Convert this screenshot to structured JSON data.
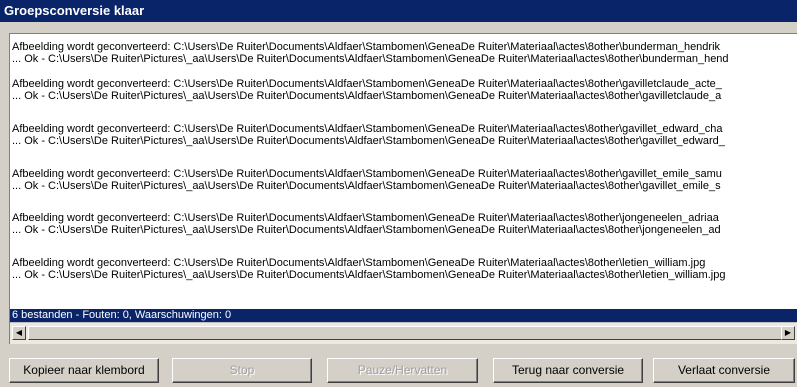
{
  "window": {
    "title": "Groepsconversie klaar"
  },
  "log": {
    "entries": [
      {
        "line1": "Afbeelding wordt geconverteerd: C:\\Users\\De Ruiter\\Documents\\Aldfaer\\Stambomen\\GeneaDe Ruiter\\Materiaal\\actes\\8other\\bunderman_hendrik",
        "line2": "... Ok - C:\\Users\\De Ruiter\\Pictures\\_aa\\Users\\De Ruiter\\Documents\\Aldfaer\\Stambomen\\GeneaDe Ruiter\\Materiaal\\actes\\8other\\bunderman_hend"
      },
      {
        "line1": "Afbeelding wordt geconverteerd: C:\\Users\\De Ruiter\\Documents\\Aldfaer\\Stambomen\\GeneaDe Ruiter\\Materiaal\\actes\\8other\\gavilletclaude_acte_",
        "line2": "... Ok - C:\\Users\\De Ruiter\\Pictures\\_aa\\Users\\De Ruiter\\Documents\\Aldfaer\\Stambomen\\GeneaDe Ruiter\\Materiaal\\actes\\8other\\gavilletclaude_a"
      },
      {
        "line1": "Afbeelding wordt geconverteerd: C:\\Users\\De Ruiter\\Documents\\Aldfaer\\Stambomen\\GeneaDe Ruiter\\Materiaal\\actes\\8other\\gavillet_edward_cha",
        "line2": "... Ok - C:\\Users\\De Ruiter\\Pictures\\_aa\\Users\\De Ruiter\\Documents\\Aldfaer\\Stambomen\\GeneaDe Ruiter\\Materiaal\\actes\\8other\\gavillet_edward_"
      },
      {
        "line1": "Afbeelding wordt geconverteerd: C:\\Users\\De Ruiter\\Documents\\Aldfaer\\Stambomen\\GeneaDe Ruiter\\Materiaal\\actes\\8other\\gavillet_emile_samu",
        "line2": "... Ok - C:\\Users\\De Ruiter\\Pictures\\_aa\\Users\\De Ruiter\\Documents\\Aldfaer\\Stambomen\\GeneaDe Ruiter\\Materiaal\\actes\\8other\\gavillet_emile_s"
      },
      {
        "line1": "Afbeelding wordt geconverteerd: C:\\Users\\De Ruiter\\Documents\\Aldfaer\\Stambomen\\GeneaDe Ruiter\\Materiaal\\actes\\8other\\jongeneelen_adriaa",
        "line2": "... Ok - C:\\Users\\De Ruiter\\Pictures\\_aa\\Users\\De Ruiter\\Documents\\Aldfaer\\Stambomen\\GeneaDe Ruiter\\Materiaal\\actes\\8other\\jongeneelen_ad"
      },
      {
        "line1": "Afbeelding wordt geconverteerd: C:\\Users\\De Ruiter\\Documents\\Aldfaer\\Stambomen\\GeneaDe Ruiter\\Materiaal\\actes\\8other\\letien_william.jpg",
        "line2": "... Ok - C:\\Users\\De Ruiter\\Pictures\\_aa\\Users\\De Ruiter\\Documents\\Aldfaer\\Stambomen\\GeneaDe Ruiter\\Materiaal\\actes\\8other\\letien_william.jpg"
      }
    ],
    "status": "6 bestanden - Fouten: 0, Waarschuwingen: 0"
  },
  "scrollbar": {
    "left_icon": "scroll-left-arrow",
    "right_icon": "scroll-right-arrow"
  },
  "buttons": {
    "copy": "Kopieer naar klembord",
    "stop": "Stop",
    "pause": "Pauze/Hervatten",
    "back": "Terug naar conversie",
    "leave": "Verlaat conversie"
  }
}
